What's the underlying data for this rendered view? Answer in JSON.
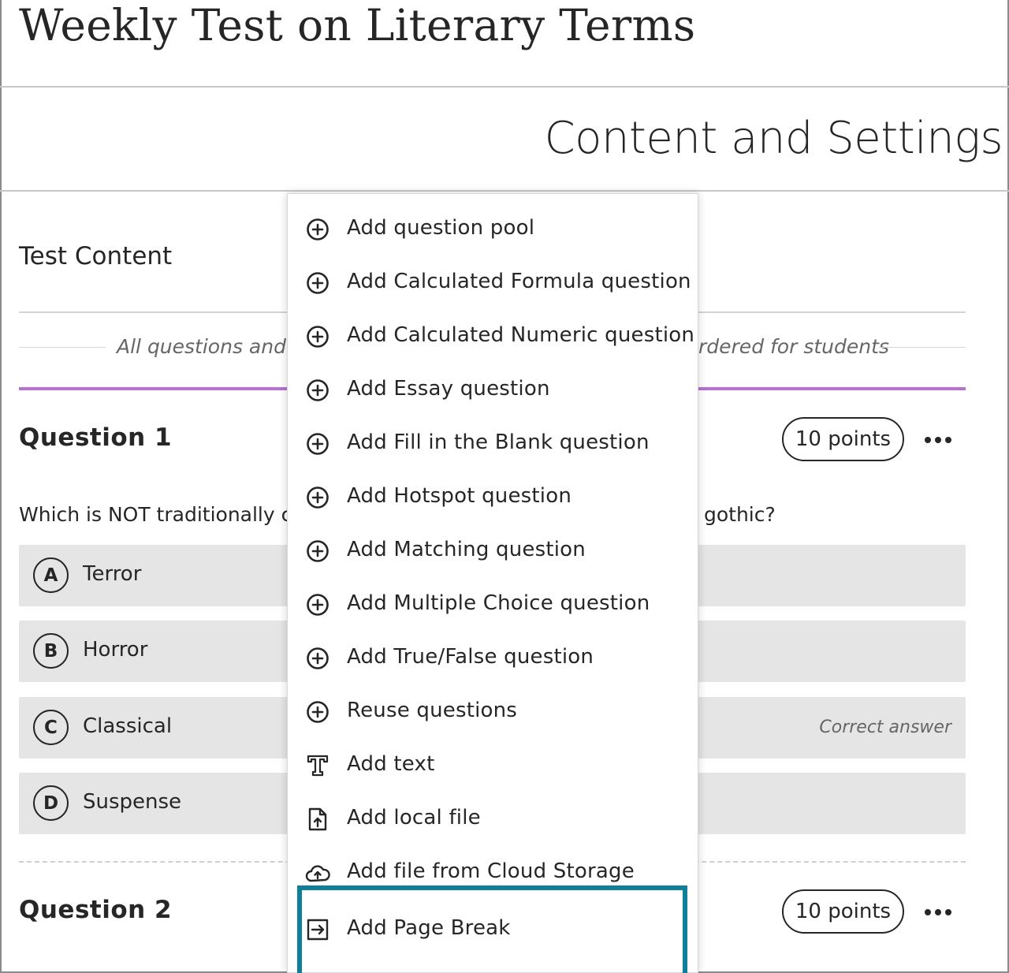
{
  "header": {
    "title": "Weekly Test on Literary Terms"
  },
  "subheader": {
    "title": "Content and Settings"
  },
  "content": {
    "label": "Test Content",
    "notice_left": "All questions and M",
    "notice_right": "rdered for students"
  },
  "questions": [
    {
      "title": "Question 1",
      "points": "10 points",
      "text_left": "Which is NOT traditionally co",
      "text_right": "gothic?",
      "answers": [
        {
          "letter": "A",
          "text": "Terror"
        },
        {
          "letter": "B",
          "text": "Horror"
        },
        {
          "letter": "C",
          "text": "Classical",
          "note": "Correct answer"
        },
        {
          "letter": "D",
          "text": "Suspense"
        }
      ]
    },
    {
      "title": "Question 2",
      "points": "10 points"
    }
  ],
  "menu": {
    "items": [
      {
        "label": "Add question pool",
        "icon": "plus-circle-icon"
      },
      {
        "label": "Add Calculated Formula question",
        "icon": "plus-circle-icon"
      },
      {
        "label": "Add Calculated Numeric question",
        "icon": "plus-circle-icon"
      },
      {
        "label": "Add Essay question",
        "icon": "plus-circle-icon"
      },
      {
        "label": "Add Fill in the Blank question",
        "icon": "plus-circle-icon"
      },
      {
        "label": "Add Hotspot question",
        "icon": "plus-circle-icon"
      },
      {
        "label": "Add Matching question",
        "icon": "plus-circle-icon"
      },
      {
        "label": "Add Multiple Choice question",
        "icon": "plus-circle-icon"
      },
      {
        "label": "Add True/False question",
        "icon": "plus-circle-icon"
      },
      {
        "label": "Reuse questions",
        "icon": "plus-circle-icon"
      },
      {
        "label": "Add text",
        "icon": "text-icon"
      },
      {
        "label": "Add local file",
        "icon": "file-upload-icon"
      },
      {
        "label": "Add file from Cloud Storage",
        "icon": "cloud-upload-icon"
      },
      {
        "label": "Add Page Break",
        "icon": "page-break-icon"
      }
    ]
  },
  "colors": {
    "accent_purple": "#b96fd5",
    "focus_teal": "#0f7e99"
  }
}
